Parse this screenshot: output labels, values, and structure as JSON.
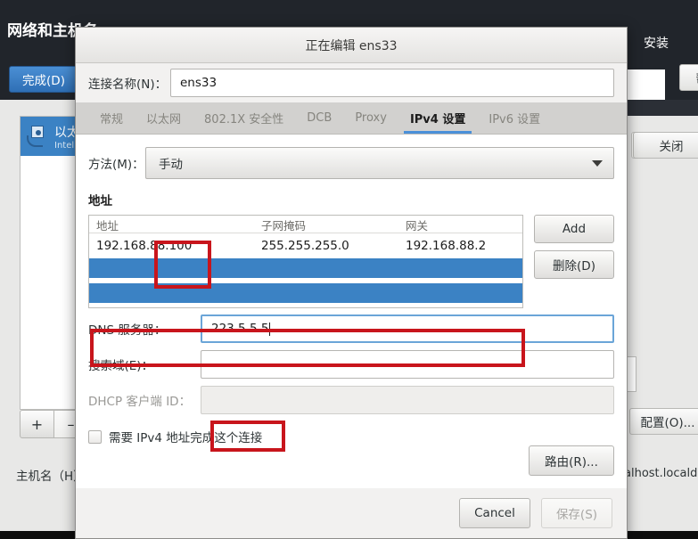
{
  "background": {
    "header_title": "网络和主机名",
    "done_button": "完成(D)",
    "install_label": "安装",
    "help_button": "帮助",
    "device": {
      "name": "以太网",
      "detail": "Intel"
    },
    "add_button": "+",
    "remove_button": "–",
    "hostname_label": "主机名（H）",
    "config_button": "配置(O)...",
    "close_button": "关闭",
    "domain_text": "alhost.localdom"
  },
  "dialog": {
    "title": "正在编辑 ens33",
    "connection_name_label": "连接名称(N)：",
    "connection_name_value": "ens33",
    "tabs": [
      {
        "label": "常规",
        "active": false
      },
      {
        "label": "以太网",
        "active": false
      },
      {
        "label": "802.1X 安全性",
        "active": false
      },
      {
        "label": "DCB",
        "active": false
      },
      {
        "label": "Proxy",
        "active": false
      },
      {
        "label": "IPv4 设置",
        "active": true
      },
      {
        "label": "IPv6 设置",
        "active": false
      }
    ],
    "method": {
      "label": "方法(M)：",
      "value": "手动",
      "arrow_icon": "chevron-down-icon"
    },
    "addresses": {
      "section_title": "地址",
      "columns": [
        "地址",
        "子网掩码",
        "网关"
      ],
      "rows": [
        {
          "address": "192.168.88.100",
          "netmask": "255.255.255.0",
          "gateway": "192.168.88.2"
        }
      ],
      "add_button": "Add",
      "delete_button": "删除(D)",
      "selection_color": "#3b82c4"
    },
    "fields": {
      "dns_label": "DNS 服务器：",
      "dns_value": "223.5.5.5",
      "search_label": "搜索域(E)：",
      "search_value": "",
      "dhcp_label": "DHCP 客户端 ID：",
      "dhcp_value": ""
    },
    "require_ipv4_checkbox": {
      "label": "需要 IPv4 地址完成这个连接",
      "checked": false
    },
    "routes_button": "路由(R)...",
    "cancel_button": "Cancel",
    "save_button": "保存(S)"
  },
  "annotations": {
    "highlight_color": "#c8151c",
    "boxes": [
      "method-value",
      "address-row",
      "dns-value"
    ]
  }
}
